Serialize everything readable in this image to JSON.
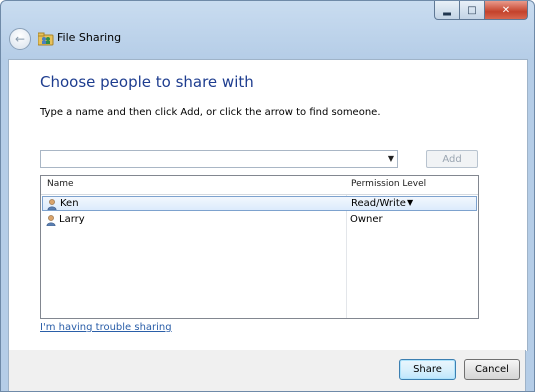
{
  "window": {
    "title": "File Sharing",
    "controls": [
      "minimize",
      "maximize",
      "close"
    ]
  },
  "header": {
    "back_icon": "back-arrow-icon"
  },
  "main": {
    "heading": "Choose people to share with",
    "instructions": "Type a name and then click Add, or click the arrow to find someone.",
    "name_input": {
      "value": "",
      "placeholder": ""
    },
    "add_button": {
      "label": "Add",
      "enabled": false
    },
    "table": {
      "columns": [
        "Name",
        "Permission Level"
      ],
      "rows": [
        {
          "name": "Ken",
          "permission": "Read/Write",
          "selected": true,
          "has_dropdown": true
        },
        {
          "name": "Larry",
          "permission": "Owner",
          "selected": false,
          "has_dropdown": false
        }
      ]
    },
    "help_link": "I'm having trouble sharing"
  },
  "footer": {
    "share_label": "Share",
    "cancel_label": "Cancel"
  },
  "colors": {
    "heading": "#1e3d8f",
    "link": "#2a5ea8",
    "selection": "#dcebfc",
    "frame": "#b5cde7"
  }
}
